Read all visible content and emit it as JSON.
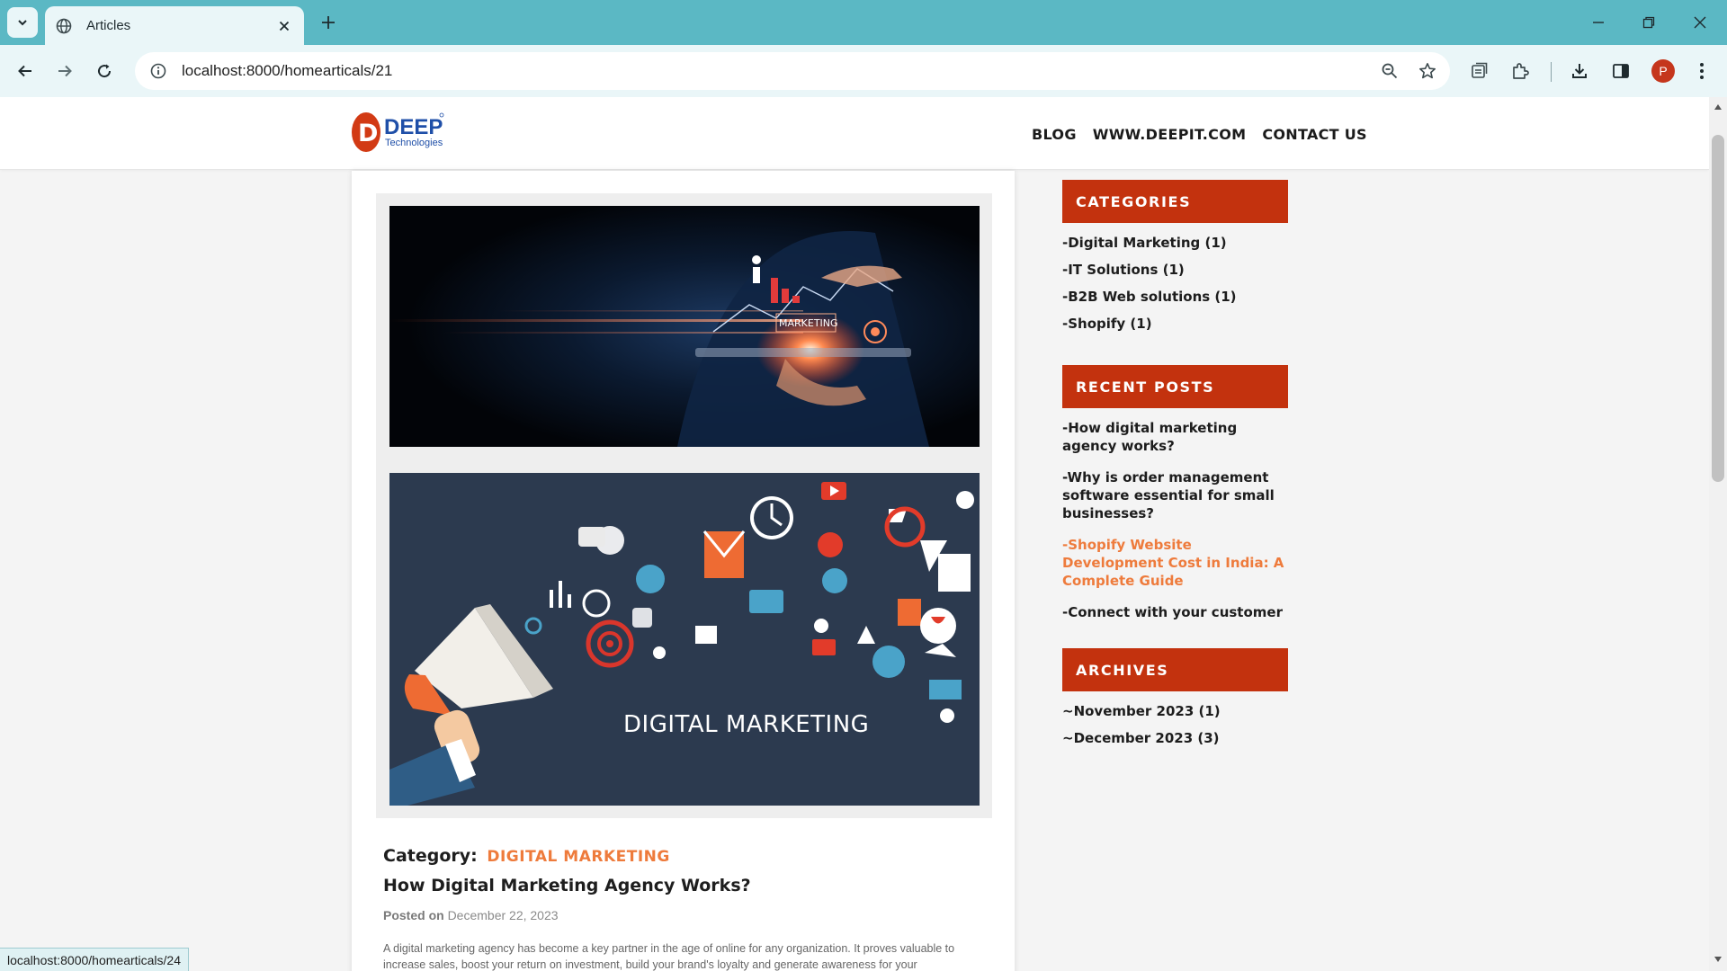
{
  "browser": {
    "tab_title": "Articles",
    "url": "localhost:8000/homearticals/21",
    "profile_initial": "P",
    "status_url": "localhost:8000/homearticals/24",
    "icons": [
      "tab-search-icon",
      "globe-icon",
      "close-icon",
      "plus-icon",
      "minimize-icon",
      "restore-icon",
      "back-icon",
      "forward-icon",
      "reload-icon",
      "site-info-icon",
      "zoom-icon",
      "star-icon",
      "tab-capture-icon",
      "extensions-icon",
      "download-icon",
      "side-panel-icon",
      "kebab-menu-icon"
    ]
  },
  "site": {
    "logo_text": "DEEP",
    "logo_sub": "Technologies",
    "nav": [
      "BLOG",
      "WWW.DEEPIT.COM",
      "CONTACT US"
    ]
  },
  "article": {
    "image2_caption": "DIGITAL MARKETING",
    "image1_caption": "MARKETING",
    "category_label": "Category:",
    "category_value": "DIGITAL MARKETING",
    "title": "How Digital Marketing Agency Works?",
    "posted_label": "Posted on",
    "posted_date": "December 22, 2023",
    "excerpt": "A digital marketing agency has become a key partner in the age of online for any organization. It proves valuable to increase sales, boost your return on investment, build your brand's loyalty and generate awareness for your"
  },
  "sidebar": {
    "categories": {
      "heading": "CATEGORIES",
      "items": [
        "-Digital Marketing (1)",
        "-IT Solutions (1)",
        "-B2B Web solutions (1)",
        "-Shopify (1)"
      ]
    },
    "recent_posts": {
      "heading": "RECENT POSTS",
      "items": [
        "-How digital marketing agency works?",
        "-Why is order management software essential for small businesses?",
        "-Shopify Website Development Cost in India: A Complete Guide",
        "-Connect with your customer"
      ],
      "active_index": 2
    },
    "archives": {
      "heading": "ARCHIVES",
      "items": [
        "~November 2023 (1)",
        "~December 2023 (3)"
      ]
    }
  },
  "colors": {
    "browser_frame": "#5bb8c4",
    "sidebar_heading": "#c3320e",
    "accent_orange": "#ee7b3c"
  }
}
